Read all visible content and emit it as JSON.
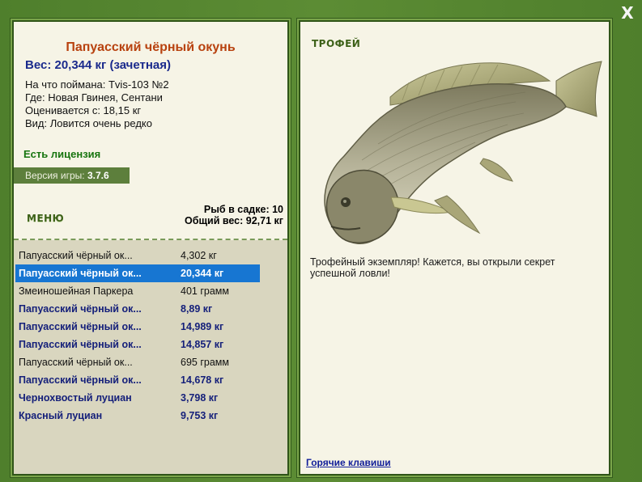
{
  "window": {
    "close_label": "X"
  },
  "fish_card": {
    "name": "Папуасский чёрный окунь",
    "weight": "Вес: 20,344 кг (зачетная)",
    "caught_with": "На что поймана: Tvis-103 №2",
    "location": "Где: Новая Гвинея, Сентани",
    "valued_from": "Оценивается с: 18,15 кг",
    "rarity": "Вид: Ловится очень редко"
  },
  "license": "Есть лицензия",
  "version": {
    "label": "Версия игры:",
    "value": "3.7.6"
  },
  "menu_label": "МЕНЮ",
  "stats": {
    "fish_in_keepnet": "Рыб в садке: 10",
    "total_weight": "Общий вес: 92,71 кг"
  },
  "catch_list": [
    {
      "name": "Папуасский чёрный ок...",
      "weight": "4,302 кг",
      "style": "normal"
    },
    {
      "name": "Папуасский чёрный ок...",
      "weight": "20,344 кг",
      "style": "selected"
    },
    {
      "name": "Змеиношейная Паркера",
      "weight": "401 грамм",
      "style": "normal"
    },
    {
      "name": "Папуасский чёрный ок...",
      "weight": "8,89 кг",
      "style": "bold"
    },
    {
      "name": "Папуасский чёрный ок...",
      "weight": "14,989 кг",
      "style": "bold"
    },
    {
      "name": "Папуасский чёрный ок...",
      "weight": "14,857 кг",
      "style": "bold"
    },
    {
      "name": "Папуасский чёрный ок...",
      "weight": "695 грамм",
      "style": "normal"
    },
    {
      "name": "Папуасский чёрный ок...",
      "weight": "14,678 кг",
      "style": "bold"
    },
    {
      "name": "Чернохвостый луциан",
      "weight": "3,798 кг",
      "style": "bold"
    },
    {
      "name": "Красный луциан",
      "weight": "9,753 кг",
      "style": "bold"
    }
  ],
  "trophy": {
    "label": "ТРОФЕЙ",
    "description": "Трофейный экземпляр! Кажется, вы открыли секрет успешной ловли!"
  },
  "hotkeys_label": "Горячие клавиши",
  "colors": {
    "background": "#4f7f2c",
    "panel": "#f6f4e6",
    "list_background": "#d9d6bf",
    "selected_row": "#1776d2",
    "fish_name": "#b8420f",
    "bold_row_text": "#15207a",
    "license": "#17750f"
  }
}
